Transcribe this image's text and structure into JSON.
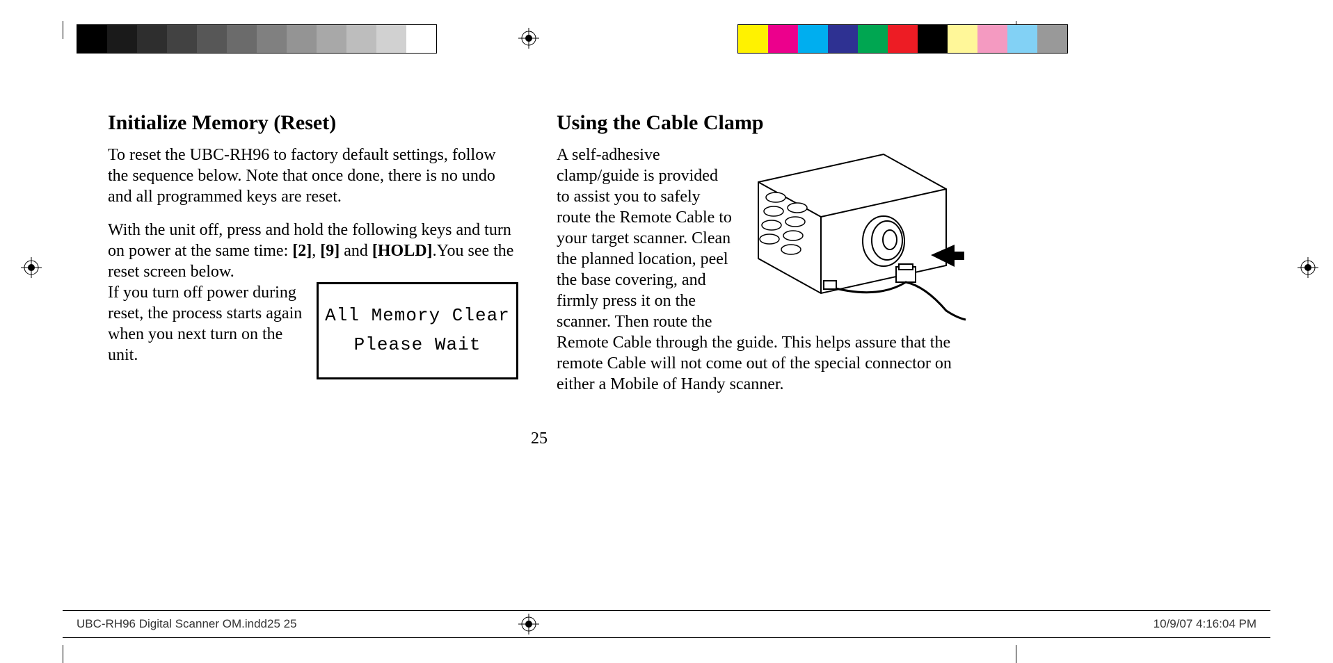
{
  "left": {
    "heading": "Initialize Memory (Reset)",
    "p1": "To reset the UBC-RH96 to factory default settings, follow the sequence below. Note that once done, there is no undo and all programmed keys are reset.",
    "p2_a": "With the unit off, press and hold the following keys and turn on power at the same time: ",
    "p2_keys": "[2], [9] and [HOLD]",
    "p2_b": ".You see the reset screen below.",
    "p3": "If you turn off power during reset, the process starts again when you next turn on the unit.",
    "lcd_line1": "All Memory Clear",
    "lcd_line2": "Please Wait"
  },
  "right": {
    "heading": "Using the Cable Clamp",
    "p1": "A self-adhesive clamp/guide is provided to assist you to safely route the Remote Cable to your target scanner. Clean the planned location, peel the base covering, and firmly press it on the scanner. Then route the Remote Cable through the guide. This helps assure that the remote Cable will not come out of the special connector on either a Mobile of Handy scanner."
  },
  "page_number": "25",
  "footer": {
    "file_left": "UBC-RH96 Digital Scanner OM.indd25   25",
    "date_right": "10/9/07   4:16:04 PM"
  },
  "grayscale_steps": [
    "#000000",
    "#1a1a1a",
    "#2e2e2e",
    "#424242",
    "#575757",
    "#6b6b6b",
    "#808080",
    "#949494",
    "#a8a8a8",
    "#bdbdbd",
    "#d1d1d1",
    "#ffffff"
  ],
  "color_steps": [
    "#fff200",
    "#ec008c",
    "#00aeef",
    "#2e3192",
    "#00a651",
    "#ed1c24",
    "#000000",
    "#fff799",
    "#f49ac1",
    "#82d1f5",
    "#999999"
  ]
}
